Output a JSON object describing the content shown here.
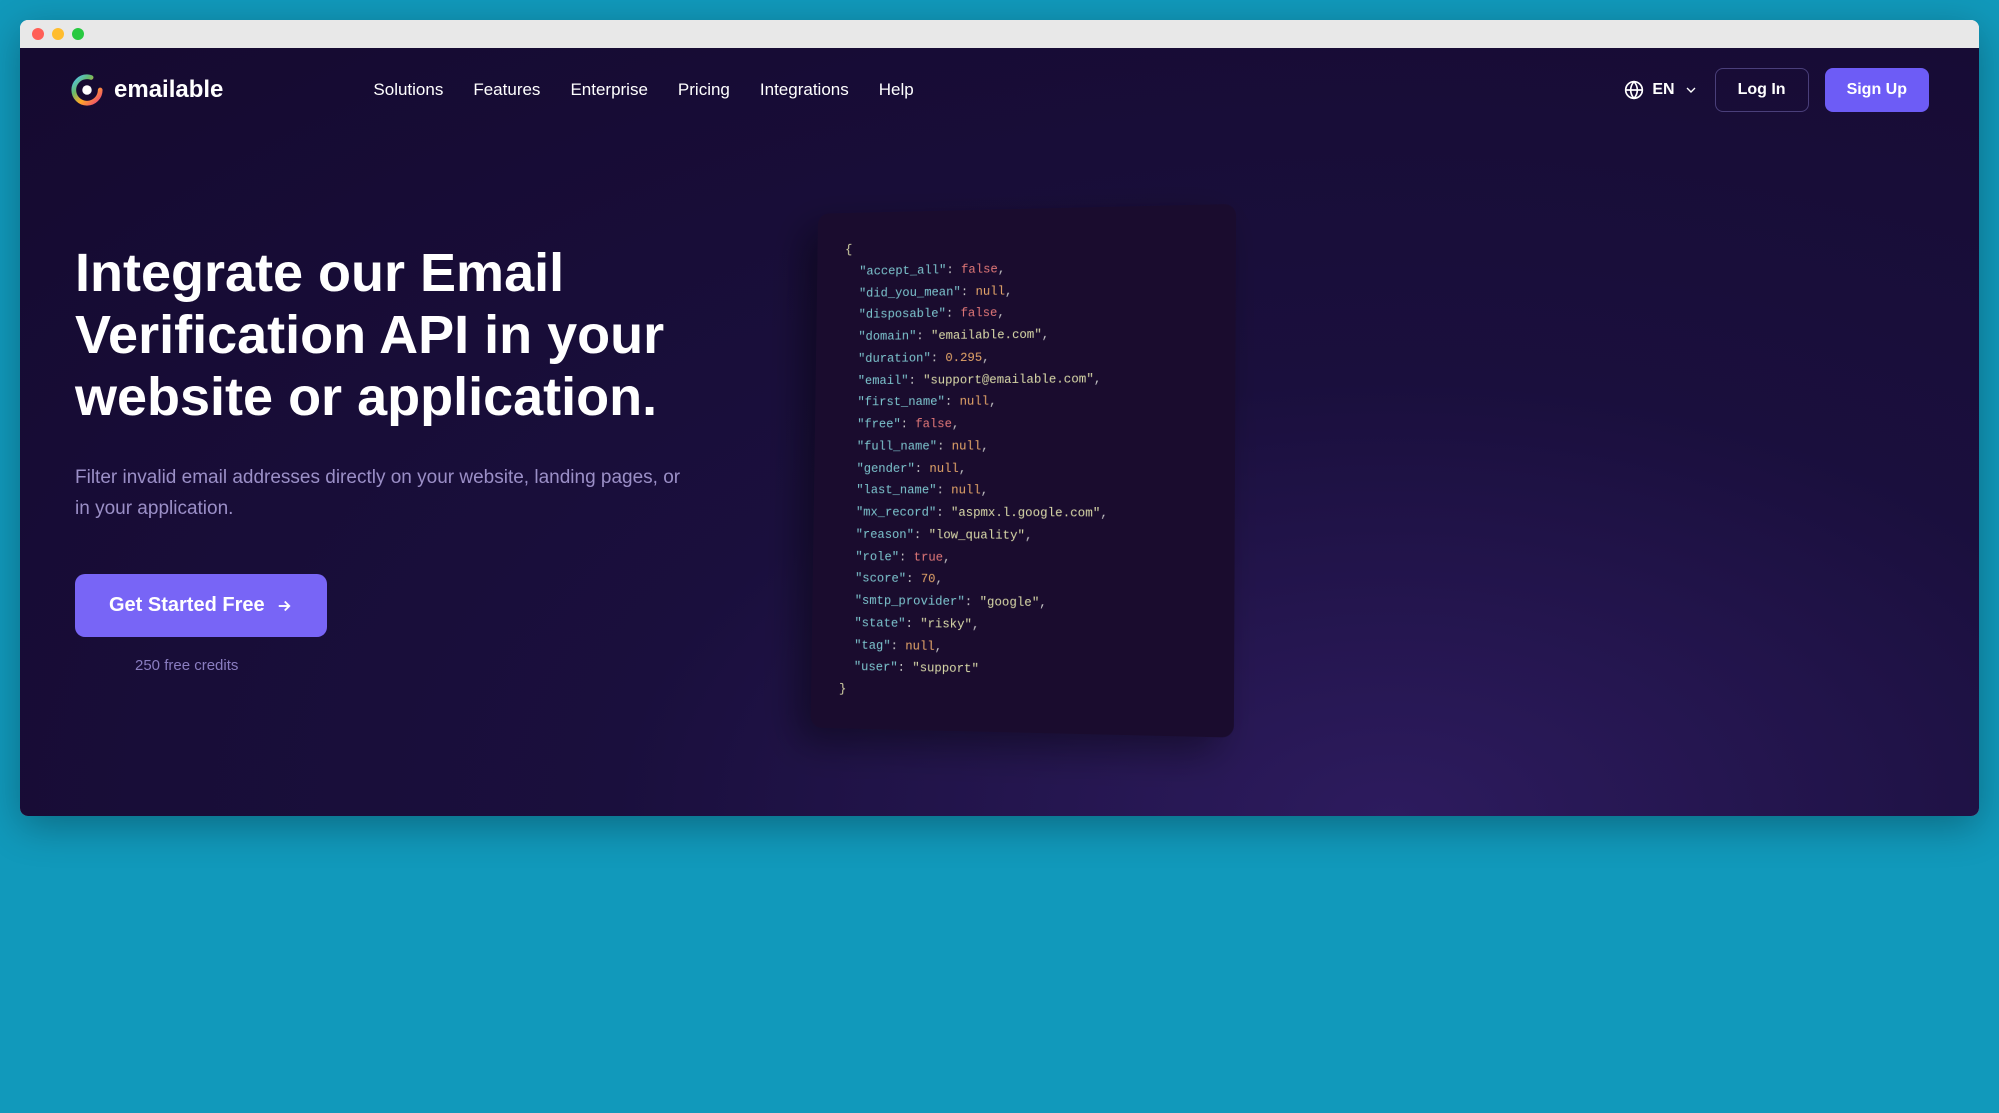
{
  "brand": "emailable",
  "nav": {
    "items": [
      "Solutions",
      "Features",
      "Enterprise",
      "Pricing",
      "Integrations",
      "Help"
    ],
    "language": "EN",
    "login": "Log In",
    "signup": "Sign Up"
  },
  "hero": {
    "title": "Integrate our Email Verification API in your website or application.",
    "subtitle": "Filter invalid email addresses directly on your website, landing pages, or in your application.",
    "cta": "Get Started Free",
    "credits": "250 free credits"
  },
  "code": {
    "lines": [
      {
        "key": "accept_all",
        "val": "false",
        "type": "bool"
      },
      {
        "key": "did_you_mean",
        "val": "null",
        "type": "null"
      },
      {
        "key": "disposable",
        "val": "false",
        "type": "bool"
      },
      {
        "key": "domain",
        "val": "\"emailable.com\"",
        "type": "string"
      },
      {
        "key": "duration",
        "val": "0.295",
        "type": "num"
      },
      {
        "key": "email",
        "val": "\"support@emailable.com\"",
        "type": "string"
      },
      {
        "key": "first_name",
        "val": "null",
        "type": "null"
      },
      {
        "key": "free",
        "val": "false",
        "type": "bool"
      },
      {
        "key": "full_name",
        "val": "null",
        "type": "null"
      },
      {
        "key": "gender",
        "val": "null",
        "type": "null"
      },
      {
        "key": "last_name",
        "val": "null",
        "type": "null"
      },
      {
        "key": "mx_record",
        "val": "\"aspmx.l.google.com\"",
        "type": "string"
      },
      {
        "key": "reason",
        "val": "\"low_quality\"",
        "type": "string"
      },
      {
        "key": "role",
        "val": "true",
        "type": "bool"
      },
      {
        "key": "score",
        "val": "70",
        "type": "num"
      },
      {
        "key": "smtp_provider",
        "val": "\"google\"",
        "type": "string"
      },
      {
        "key": "state",
        "val": "\"risky\"",
        "type": "string"
      },
      {
        "key": "tag",
        "val": "null",
        "type": "null"
      },
      {
        "key": "user",
        "val": "\"support\"",
        "type": "string",
        "last": true
      }
    ]
  }
}
